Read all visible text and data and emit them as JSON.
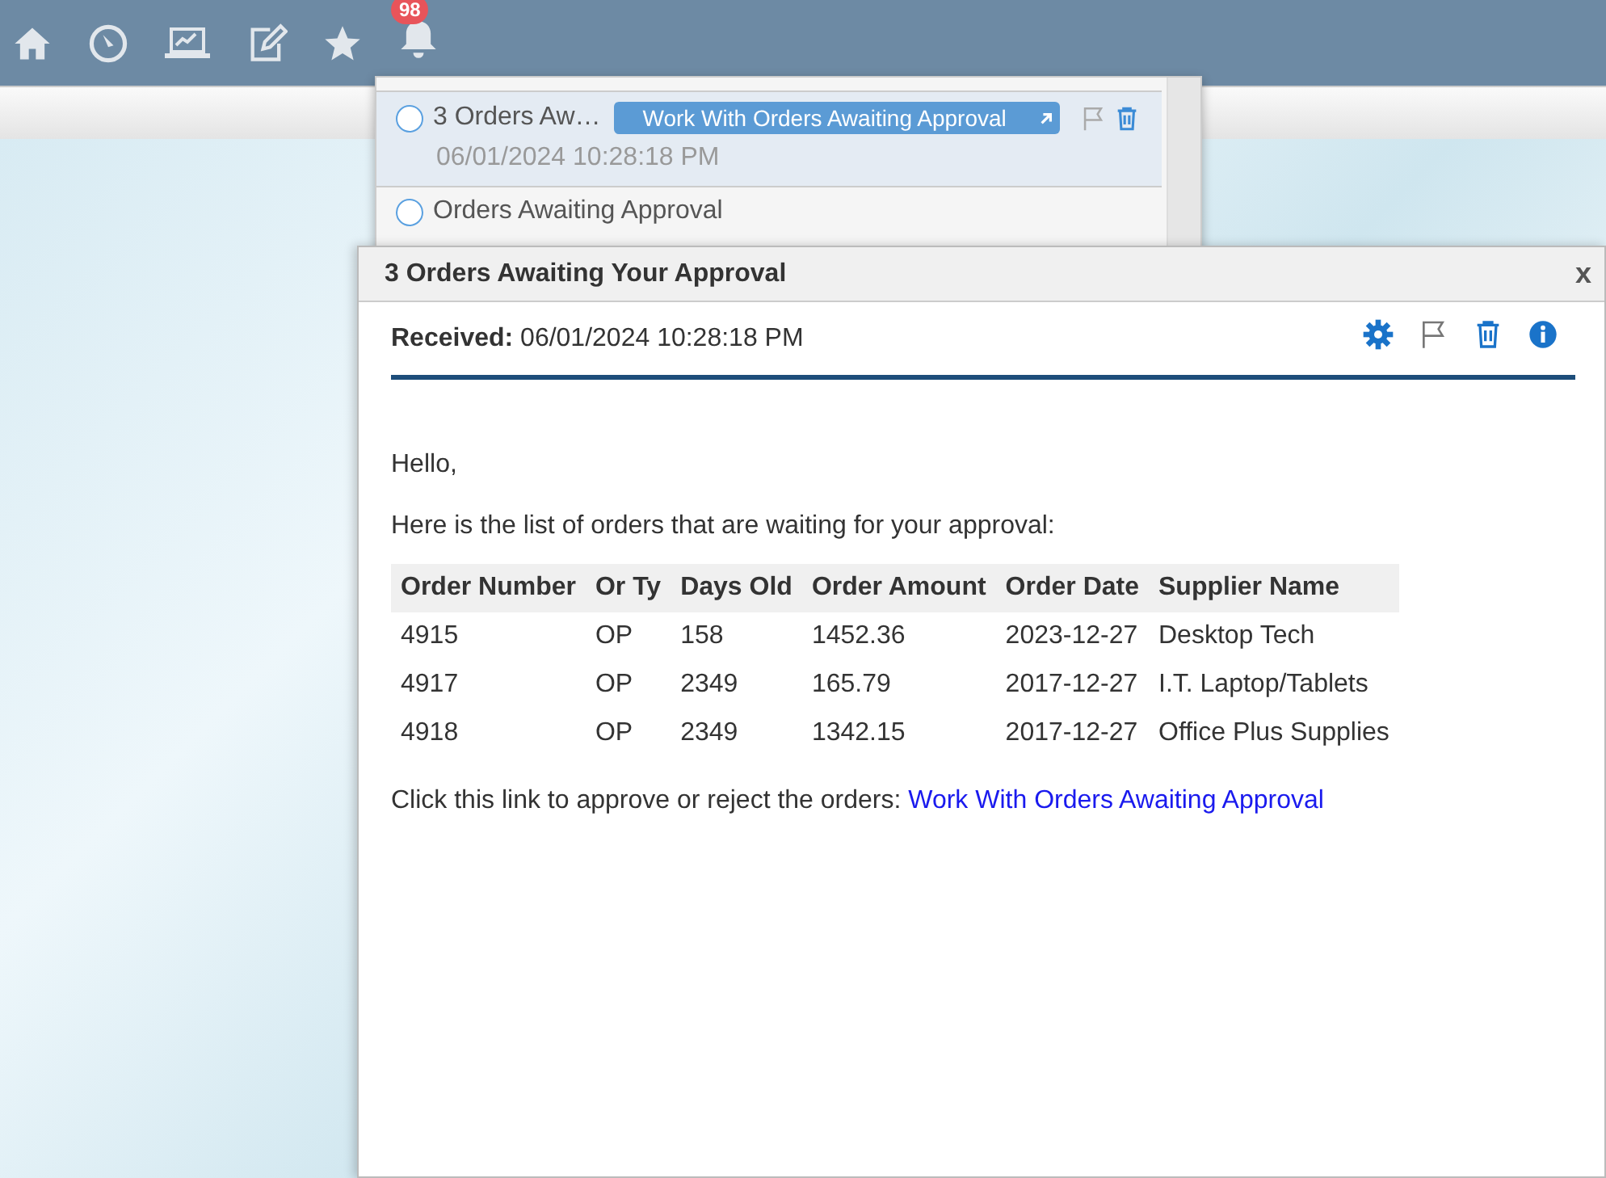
{
  "toolbar": {
    "notification_count": "98"
  },
  "notifications": [
    {
      "title": "3 Orders Aw…",
      "action": "Work With Orders Awaiting Approval",
      "time": "06/01/2024 10:28:18 PM",
      "selected": true
    },
    {
      "title": "Orders Awaiting Approval",
      "selected": false
    }
  ],
  "dialog": {
    "title": "3 Orders Awaiting Your Approval",
    "close": "x",
    "received_label": "Received:",
    "received": "06/01/2024 10:28:18 PM",
    "greeting": "Hello,",
    "intro": "Here is the list of orders that are waiting for your approval:",
    "table": {
      "columns": [
        "Order Number",
        "Or Ty",
        "Days Old",
        "Order Amount",
        "Order Date",
        "Supplier Name"
      ],
      "rows": [
        [
          "4915",
          "OP",
          "158",
          "1452.36",
          "2023-12-27",
          "Desktop Tech"
        ],
        [
          "4917",
          "OP",
          "2349",
          "165.79",
          "2017-12-27",
          "I.T. Laptop/Tablets"
        ],
        [
          "4918",
          "OP",
          "2349",
          "1342.15",
          "2017-12-27",
          "Office Plus Supplies"
        ]
      ]
    },
    "link_text": "Click this link to approve or reject the orders:",
    "link": "Work With Orders Awaiting Approval"
  }
}
